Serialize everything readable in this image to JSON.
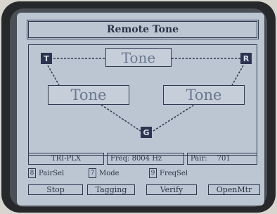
{
  "title": "Remote Tone",
  "nodes": {
    "t": "T",
    "r": "R",
    "g": "G"
  },
  "tones": {
    "top": "Tone",
    "left": "Tone",
    "right": "Tone"
  },
  "status": {
    "mode": "TRI-PLX",
    "freq": "Freq: 8004 Hz",
    "pair_label": "Pair:",
    "pair_value": "701"
  },
  "keys": [
    {
      "key": "8",
      "label": "PairSel"
    },
    {
      "key": "7",
      "label": "Mode"
    },
    {
      "key": "9",
      "label": "FreqSel"
    }
  ],
  "buttons": [
    "Stop",
    "Tagging",
    "Verify",
    "OpenMtr"
  ],
  "colors": {
    "screen": "#bcc6d2",
    "ink": "#2b3446",
    "node_fill": "#2b3550",
    "faded_text": "#6a7890"
  }
}
